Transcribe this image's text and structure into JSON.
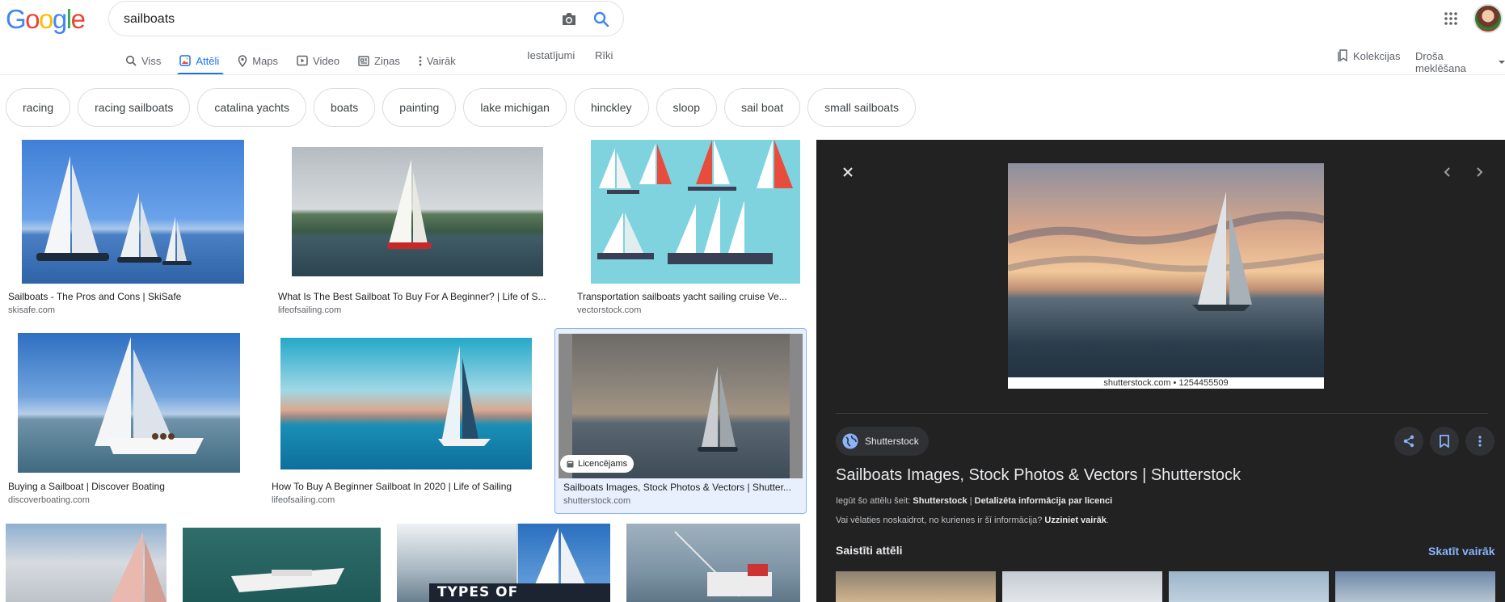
{
  "logo": [
    "G",
    "o",
    "o",
    "g",
    "l",
    "e"
  ],
  "search": {
    "query": "sailboats"
  },
  "tabs": [
    {
      "label": "Viss",
      "icon": "search-icon"
    },
    {
      "label": "Attēli",
      "icon": "image-icon"
    },
    {
      "label": "Maps",
      "icon": "map-pin-icon"
    },
    {
      "label": "Video",
      "icon": "video-icon"
    },
    {
      "label": "Ziņas",
      "icon": "news-icon"
    },
    {
      "label": "Vairāk",
      "icon": "more-vert-icon"
    }
  ],
  "tools": {
    "settings": "Iestatījumi",
    "tools": "Rīki"
  },
  "header_right": {
    "collections": "Kolekcijas",
    "safe_search": "Droša meklēšana"
  },
  "chips": [
    "racing",
    "racing sailboats",
    "catalina yachts",
    "boats",
    "painting",
    "lake michigan",
    "hinckley",
    "sloop",
    "sail boat",
    "small sailboats"
  ],
  "results": [
    {
      "title": "Sailboats - The Pros and Cons | SkiSafe",
      "source": "skisafe.com"
    },
    {
      "title": "What Is The Best Sailboat To Buy For A Beginner? | Life of S...",
      "source": "lifeofsailing.com"
    },
    {
      "title": "Transportation sailboats yacht sailing cruise Ve...",
      "source": "vectorstock.com"
    },
    {
      "title": "Buying a Sailboat | Discover Boating",
      "source": "discoverboating.com"
    },
    {
      "title": "How To Buy A Beginner Sailboat In 2020 | Life of Sailing",
      "source": "lifeofsailing.com"
    },
    {
      "title": "Sailboats Images, Stock Photos & Vectors | Shutter...",
      "source": "shutterstock.com",
      "badge": "Licencējams"
    }
  ],
  "row3_overlay": "TYPES OF SAILBOATS",
  "panel": {
    "watermark": "shutterstock.com • 1254455509",
    "source_name": "Shutterstock",
    "title": "Sailboats Images, Stock Photos & Vectors | Shutterstock",
    "license_prefix": "Iegūt šo attēlu šeit: ",
    "license_source": "Shutterstock",
    "license_sep": " | ",
    "license_link": "Detalizēta informācija par licenci",
    "question": "Vai vēlaties noskaidrot, no kurienes ir šī informācija? ",
    "learn_more": "Uzziniet vairāk",
    "period": ".",
    "related_title": "Saistīti attēli",
    "see_more": "Skatīt vairāk"
  },
  "colors": {
    "accent": "#1a73e8",
    "panel_bg": "#222222",
    "link_blue": "#8ab4f8"
  }
}
